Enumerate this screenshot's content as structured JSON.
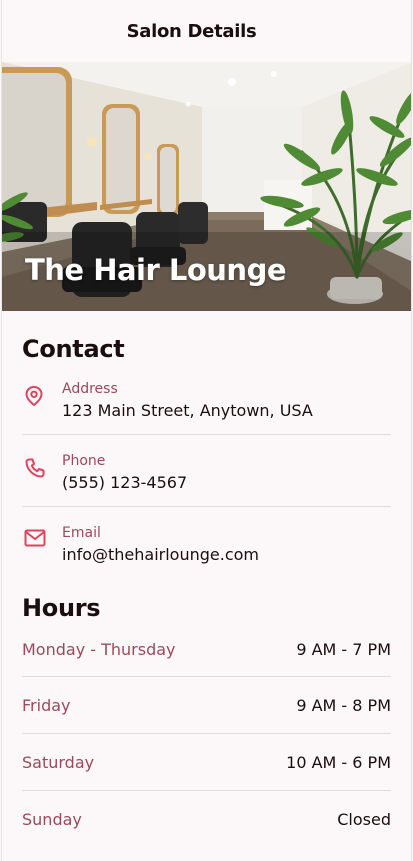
{
  "header": {
    "title": "Salon Details"
  },
  "hero": {
    "salon_name": "The Hair Lounge"
  },
  "contact": {
    "title": "Contact",
    "items": [
      {
        "icon": "location-pin-icon",
        "label": "Address",
        "value": "123 Main Street, Anytown, USA"
      },
      {
        "icon": "phone-icon",
        "label": "Phone",
        "value": "(555) 123-4567"
      },
      {
        "icon": "mail-icon",
        "label": "Email",
        "value": "info@thehairlounge.com"
      }
    ]
  },
  "hours": {
    "title": "Hours",
    "rows": [
      {
        "day": "Monday - Thursday",
        "time": "9 AM - 7 PM"
      },
      {
        "day": "Friday",
        "time": "9 AM - 8 PM"
      },
      {
        "day": "Saturday",
        "time": "10 AM - 6 PM"
      },
      {
        "day": "Sunday",
        "time": "Closed"
      }
    ]
  },
  "colors": {
    "accent": "#e0435e",
    "label": "#9a4a5a",
    "background": "#fcf7f8",
    "text": "#1b0e10"
  }
}
